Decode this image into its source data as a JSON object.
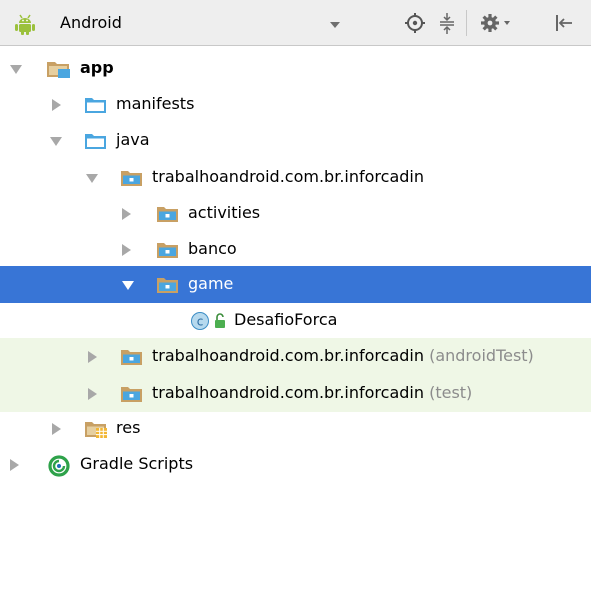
{
  "toolbar": {
    "project_view": "Android"
  },
  "tree": {
    "app": "app",
    "manifests": "manifests",
    "java": "java",
    "pkg_main": "trabalhoandroid.com.br.inforcadin",
    "activities": "activities",
    "banco": "banco",
    "game": "game",
    "desafio": "DesafioForca",
    "pkg_android_test": "trabalhoandroid.com.br.inforcadin",
    "pkg_android_test_suffix": "(androidTest)",
    "pkg_test": "trabalhoandroid.com.br.inforcadin",
    "pkg_test_suffix": "(test)",
    "res": "res",
    "gradle": "Gradle Scripts"
  },
  "colors": {
    "selection": "#3875d6",
    "test_background": "#eff7e6",
    "folder_blue": "#4aa6e0",
    "package_tan": "#c8a064",
    "android_green": "#9bc13c"
  },
  "icons": {
    "android": "android-icon",
    "locate": "crosshair-icon",
    "collapse": "collapse-all-icon",
    "settings": "gear-icon",
    "hide": "hide-panel-icon"
  }
}
